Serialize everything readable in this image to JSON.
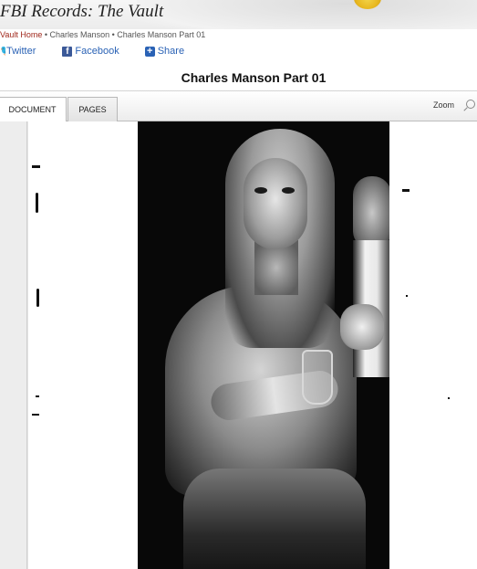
{
  "site": {
    "title": "FBI Records: The Vault"
  },
  "breadcrumb": {
    "items": [
      "Vault Home",
      "Charles Manson",
      "Charles Manson Part 01"
    ],
    "separator": "•"
  },
  "share": {
    "twitter_label": "Twitter",
    "facebook_label": "Facebook",
    "share_label": "Share"
  },
  "document": {
    "title": "Charles Manson Part 01"
  },
  "viewer": {
    "tabs": [
      {
        "label": "DOCUMENT",
        "active": true
      },
      {
        "label": "PAGES",
        "active": false
      }
    ],
    "zoom_label": "Zoom"
  },
  "colors": {
    "link": "#2a62b5",
    "breadcrumb_home": "#a0281c",
    "facebook": "#3b5998",
    "twitter": "#2aa0e6"
  },
  "icons": [
    "twitter-icon",
    "facebook-icon",
    "share-icon",
    "zoom-icon"
  ]
}
